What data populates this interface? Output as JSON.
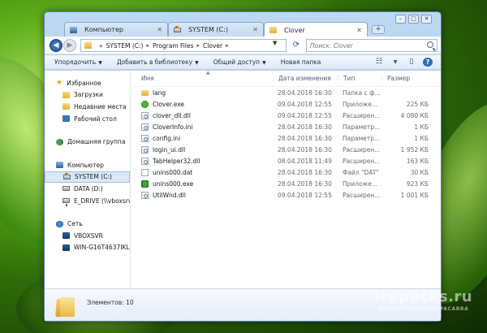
{
  "tabs": [
    {
      "label": "Компьютер",
      "icon": "computer-icon"
    },
    {
      "label": "SYSTEM (C:)",
      "icon": "drive-icon"
    },
    {
      "label": "Clover",
      "icon": "folder-icon"
    }
  ],
  "window_controls": {
    "minimize": "–",
    "maximize": "□",
    "close": "✕"
  },
  "address": {
    "prefix": "«",
    "crumbs": [
      "SYSTEM (C:)",
      "Program Files",
      "Clover"
    ]
  },
  "search": {
    "placeholder": "Поиск: Clover"
  },
  "toolbar": {
    "organize": "Упорядочить",
    "add_to_library": "Добавить в библиотеку",
    "share": "Общий доступ",
    "new_folder": "Новая папка"
  },
  "sidebar": {
    "favorites_label": "Избранное",
    "favorites": [
      "Загрузки",
      "Недавние места",
      "Рабочий стол"
    ],
    "homegroup_label": "Домашняя группа",
    "computer_label": "Компьютер",
    "drives": [
      "SYSTEM (C:)",
      "DATA (D:)",
      "E_DRIVE (\\\\vboxsrv) (E"
    ],
    "network_label": "Сеть",
    "network": [
      "VBOXSVR",
      "WIN-G16T4637IKL"
    ]
  },
  "columns": {
    "name": "Имя",
    "date": "Дата изменения",
    "type": "Тип",
    "size": "Размер"
  },
  "files": [
    {
      "name": "lang",
      "date": "28.04.2018 16:30",
      "type": "Папка с ф...",
      "size": "",
      "icon": "folder"
    },
    {
      "name": "Clover.exe",
      "date": "09.04.2018 12:55",
      "type": "Приложе...",
      "size": "225 КБ",
      "icon": "clover"
    },
    {
      "name": "clover_dll.dll",
      "date": "09.04.2018 12:55",
      "type": "Расширен...",
      "size": "4 080 КБ",
      "icon": "dll"
    },
    {
      "name": "CloverInfo.ini",
      "date": "28.04.2018 16:30",
      "type": "Параметр...",
      "size": "1 КБ",
      "icon": "ini"
    },
    {
      "name": "config.ini",
      "date": "28.04.2018 16:30",
      "type": "Параметр...",
      "size": "1 КБ",
      "icon": "ini"
    },
    {
      "name": "login_ui.dll",
      "date": "28.04.2018 16:30",
      "type": "Расширен...",
      "size": "1 952 КБ",
      "icon": "dll"
    },
    {
      "name": "TabHelper32.dll",
      "date": "08.04.2018 11:49",
      "type": "Расширен...",
      "size": "163 КБ",
      "icon": "dll"
    },
    {
      "name": "unins000.dat",
      "date": "28.04.2018 16:30",
      "type": "Файл \"DAT\"",
      "size": "30 КБ",
      "icon": "dat"
    },
    {
      "name": "unins000.exe",
      "date": "28.04.2018 16:30",
      "type": "Приложе...",
      "size": "923 КБ",
      "icon": "unins"
    },
    {
      "name": "UtilWnd.dll",
      "date": "09.04.2018 12:55",
      "type": "Расширен...",
      "size": "1 001 КБ",
      "icon": "dll"
    }
  ],
  "status": {
    "items_label": "Элементов: 10"
  },
  "watermark": {
    "main": "Irepacks.ru",
    "sub": "REPACKS BY ELCHUPACABRA"
  }
}
